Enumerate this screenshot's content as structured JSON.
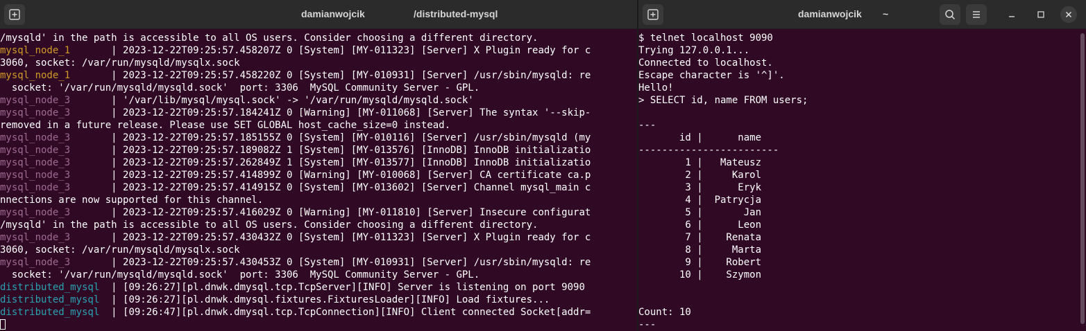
{
  "left": {
    "title_user": "damianwojcik",
    "title_path": "/distributed-mysql",
    "lines": [
      {
        "service": "",
        "text": "/mysqld' in the path is accessible to all OS users. Consider choosing a different directory."
      },
      {
        "service": "mysql_node_1",
        "cls": "n1",
        "text": "2023-12-22T09:25:57.458207Z 0 [System] [MY-011323] [Server] X Plugin ready for c"
      },
      {
        "service": "",
        "text": "3060, socket: /var/run/mysqld/mysqlx.sock"
      },
      {
        "service": "mysql_node_1",
        "cls": "n1",
        "text": "2023-12-22T09:25:57.458220Z 0 [System] [MY-010931] [Server] /usr/sbin/mysqld: re"
      },
      {
        "service": "",
        "text": "  socket: '/var/run/mysqld/mysqld.sock'  port: 3306  MySQL Community Server - GPL."
      },
      {
        "service": "mysql_node_3",
        "cls": "n3",
        "text": "'/var/lib/mysql/mysql.sock' -> '/var/run/mysqld/mysqld.sock'"
      },
      {
        "service": "mysql_node_3",
        "cls": "n3",
        "text": "2023-12-22T09:25:57.184241Z 0 [Warning] [MY-011068] [Server] The syntax '--skip-"
      },
      {
        "service": "",
        "text": "removed in a future release. Please use SET GLOBAL host_cache_size=0 instead."
      },
      {
        "service": "mysql_node_3",
        "cls": "n3",
        "text": "2023-12-22T09:25:57.185155Z 0 [System] [MY-010116] [Server] /usr/sbin/mysqld (my"
      },
      {
        "service": "mysql_node_3",
        "cls": "n3",
        "text": "2023-12-22T09:25:57.189082Z 1 [System] [MY-013576] [InnoDB] InnoDB initializatio"
      },
      {
        "service": "mysql_node_3",
        "cls": "n3",
        "text": "2023-12-22T09:25:57.262849Z 1 [System] [MY-013577] [InnoDB] InnoDB initializatio"
      },
      {
        "service": "mysql_node_3",
        "cls": "n3",
        "text": "2023-12-22T09:25:57.414899Z 0 [Warning] [MY-010068] [Server] CA certificate ca.p"
      },
      {
        "service": "mysql_node_3",
        "cls": "n3",
        "text": "2023-12-22T09:25:57.414915Z 0 [System] [MY-013602] [Server] Channel mysql_main c"
      },
      {
        "service": "",
        "text": "nnections are now supported for this channel."
      },
      {
        "service": "mysql_node_3",
        "cls": "n3",
        "text": "2023-12-22T09:25:57.416029Z 0 [Warning] [MY-011810] [Server] Insecure configurat"
      },
      {
        "service": "",
        "text": "/mysqld' in the path is accessible to all OS users. Consider choosing a different directory."
      },
      {
        "service": "mysql_node_3",
        "cls": "n3",
        "text": "2023-12-22T09:25:57.430432Z 0 [System] [MY-011323] [Server] X Plugin ready for c"
      },
      {
        "service": "",
        "text": "3060, socket: /var/run/mysqld/mysqlx.sock"
      },
      {
        "service": "mysql_node_3",
        "cls": "n3",
        "text": "2023-12-22T09:25:57.430453Z 0 [System] [MY-010931] [Server] /usr/sbin/mysqld: re"
      },
      {
        "service": "",
        "text": "  socket: '/var/run/mysqld/mysqld.sock'  port: 3306  MySQL Community Server - GPL."
      },
      {
        "service": "distributed_mysql",
        "cls": "dm",
        "text": "[09:26:27][pl.dnwk.dmysql.tcp.TcpServer][INFO] Server is listening on port 9090"
      },
      {
        "service": "distributed_mysql",
        "cls": "dm",
        "text": "[09:26:27][pl.dnwk.dmysql.fixtures.FixturesLoader][INFO] Load fixtures..."
      },
      {
        "service": "distributed_mysql",
        "cls": "dm",
        "text": "[09:26:47][pl.dnwk.dmysql.tcp.TcpConnection][INFO] Client connected Socket[addr="
      }
    ]
  },
  "right": {
    "title_user": "damianwojcik",
    "title_path": "~",
    "lines": [
      "$ telnet localhost 9090",
      "Trying 127.0.0.1...",
      "Connected to localhost.",
      "Escape character is '^]'.",
      "Hello!",
      "> SELECT id, name FROM users;",
      "",
      "---",
      "       id |      name",
      "------------------------",
      "        1 |   Mateusz",
      "        2 |     Karol",
      "        3 |      Eryk",
      "        4 |  Patrycja",
      "        5 |       Jan",
      "        6 |      Leon",
      "        7 |    Renata",
      "        8 |     Marta",
      "        9 |    Robert",
      "       10 |    Szymon",
      "",
      "",
      "Count: 10",
      "---"
    ],
    "prompt": "> "
  },
  "icons": {
    "new_tab": "new-tab-icon",
    "search": "search-icon",
    "menu": "hamburger-menu-icon",
    "minimize": "minimize-icon",
    "maximize": "maximize-icon",
    "close": "close-icon"
  }
}
